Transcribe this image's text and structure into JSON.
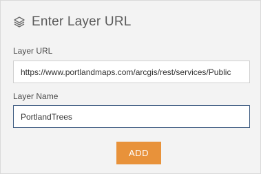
{
  "header": {
    "title": "Enter Layer URL",
    "icon": "layers-icon"
  },
  "form": {
    "url_label": "Layer URL",
    "url_value": "https://www.portlandmaps.com/arcgis/rest/services/Public",
    "name_label": "Layer Name",
    "name_value": "PortlandTrees"
  },
  "actions": {
    "add_label": "ADD"
  },
  "colors": {
    "accent": "#e8923a",
    "active_border": "#3c5a80",
    "background": "#f3f3f3"
  }
}
